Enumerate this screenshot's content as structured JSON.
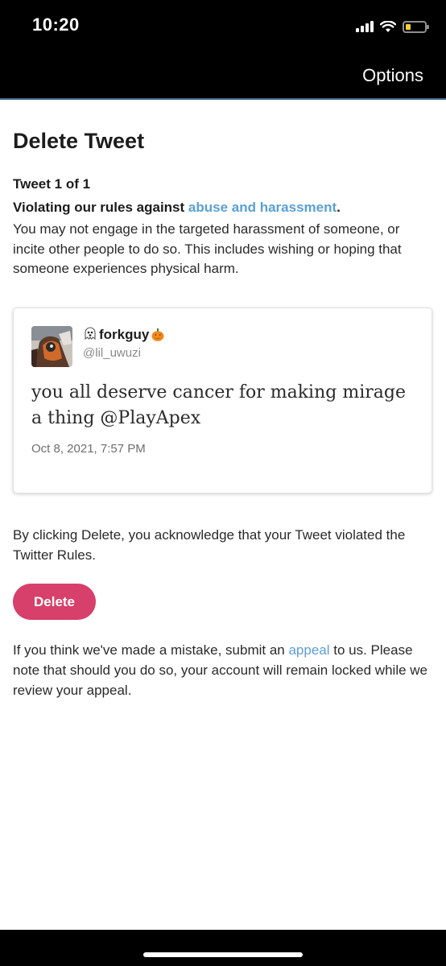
{
  "status_bar": {
    "time": "10:20"
  },
  "header": {
    "options_label": "Options"
  },
  "page": {
    "title": "Delete Tweet",
    "tweet_count": "Tweet 1 of 1",
    "violation_prefix": "Violating our rules against ",
    "violation_link": "abuse and harassment",
    "violation_suffix": ".",
    "rule_text": "You may not engage in the targeted harassment of someone, or incite other people to do so. This includes wishing or hoping that someone experiences physical harm."
  },
  "tweet": {
    "display_name": "forkguy",
    "handle": "@lil_uwuzi",
    "text": "you all deserve cancer for making mirage a thing @PlayApex",
    "timestamp": "Oct 8, 2021, 7:57 PM"
  },
  "acknowledgement": "By clicking Delete, you acknowledge that your Tweet violated the Twitter Rules.",
  "delete_button": "Delete",
  "appeal": {
    "prefix": "If you think we've made a mistake, submit an ",
    "link": "appeal",
    "suffix": " to us. Please note that should you do so, your account will remain locked while we review your appeal."
  },
  "colors": {
    "link": "#5a9fd6",
    "delete_button": "#d7406a",
    "top_bar": "#000000"
  },
  "icons": [
    "cellular-signal-icon",
    "wifi-icon",
    "battery-icon",
    "ghost-emoji-icon",
    "pumpkin-emoji-icon"
  ]
}
